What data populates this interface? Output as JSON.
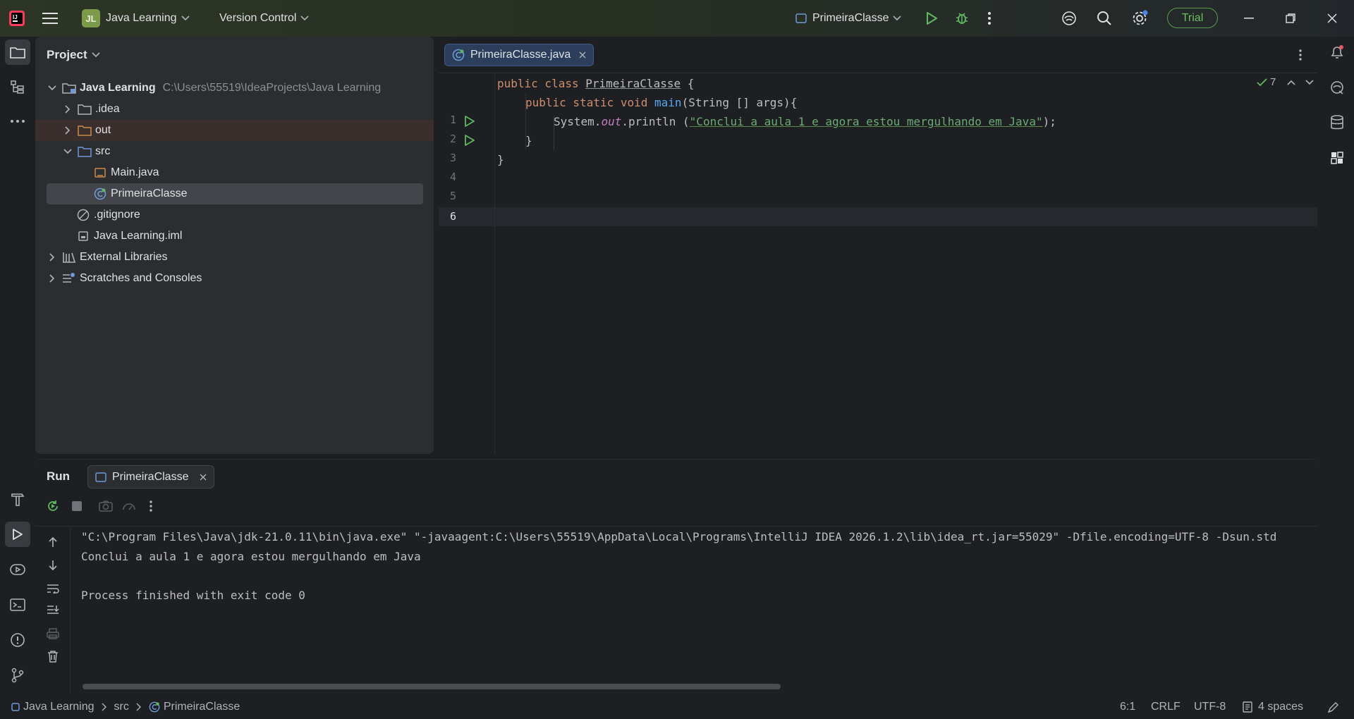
{
  "titlebar": {
    "project_badge": "JL",
    "project_name": "Java Learning",
    "vcs_label": "Version Control",
    "run_config": "PrimeiraClasse",
    "trial_label": "Trial"
  },
  "project_panel": {
    "title": "Project",
    "tree": [
      {
        "label": "Java Learning",
        "path": "C:\\Users\\55519\\IdeaProjects\\Java Learning"
      },
      {
        "label": ".idea"
      },
      {
        "label": "out"
      },
      {
        "label": "src"
      },
      {
        "label": "Main.java"
      },
      {
        "label": "PrimeiraClasse"
      },
      {
        "label": ".gitignore"
      },
      {
        "label": "Java Learning.iml"
      },
      {
        "label": "External Libraries"
      },
      {
        "label": "Scratches and Consoles"
      }
    ]
  },
  "editor": {
    "tab_label": "PrimeiraClasse.java",
    "inspection_count": "7",
    "line_numbers": [
      "1",
      "2",
      "3",
      "4",
      "5",
      "6"
    ],
    "code": {
      "l1_kw": "public class ",
      "l1_class": "PrimeiraClasse",
      "l1_rest": " {",
      "l2_kw": "public static void ",
      "l2_fn": "main",
      "l2_rest": "(String [] args){",
      "l3_pre": "System.",
      "l3_field": "out",
      "l3_mid": ".println (",
      "l3_str": "\"Conclui a aula 1 e agora estou mergulhando em Java\"",
      "l3_end": ");",
      "l4": "}",
      "l5": "}"
    }
  },
  "run_panel": {
    "title": "Run",
    "tab_label": "PrimeiraClasse",
    "output": [
      "\"C:\\Program Files\\Java\\jdk-21.0.11\\bin\\java.exe\" \"-javaagent:C:\\Users\\55519\\AppData\\Local\\Programs\\IntelliJ IDEA 2026.1.2\\lib\\idea_rt.jar=55029\" -Dfile.encoding=UTF-8 -Dsun.std",
      "Conclui a aula 1 e agora estou mergulhando em Java",
      "",
      "Process finished with exit code 0"
    ]
  },
  "statusbar": {
    "crumbs": [
      "Java Learning",
      "src",
      "PrimeiraClasse"
    ],
    "position": "6:1",
    "line_sep": "CRLF",
    "encoding": "UTF-8",
    "indent": "4 spaces"
  },
  "colors": {
    "accent_green": "#6fbf5f",
    "run_green": "#5fb85f",
    "folder_blue": "#6e9ad6",
    "excluded_orange": "#c98a4b"
  }
}
